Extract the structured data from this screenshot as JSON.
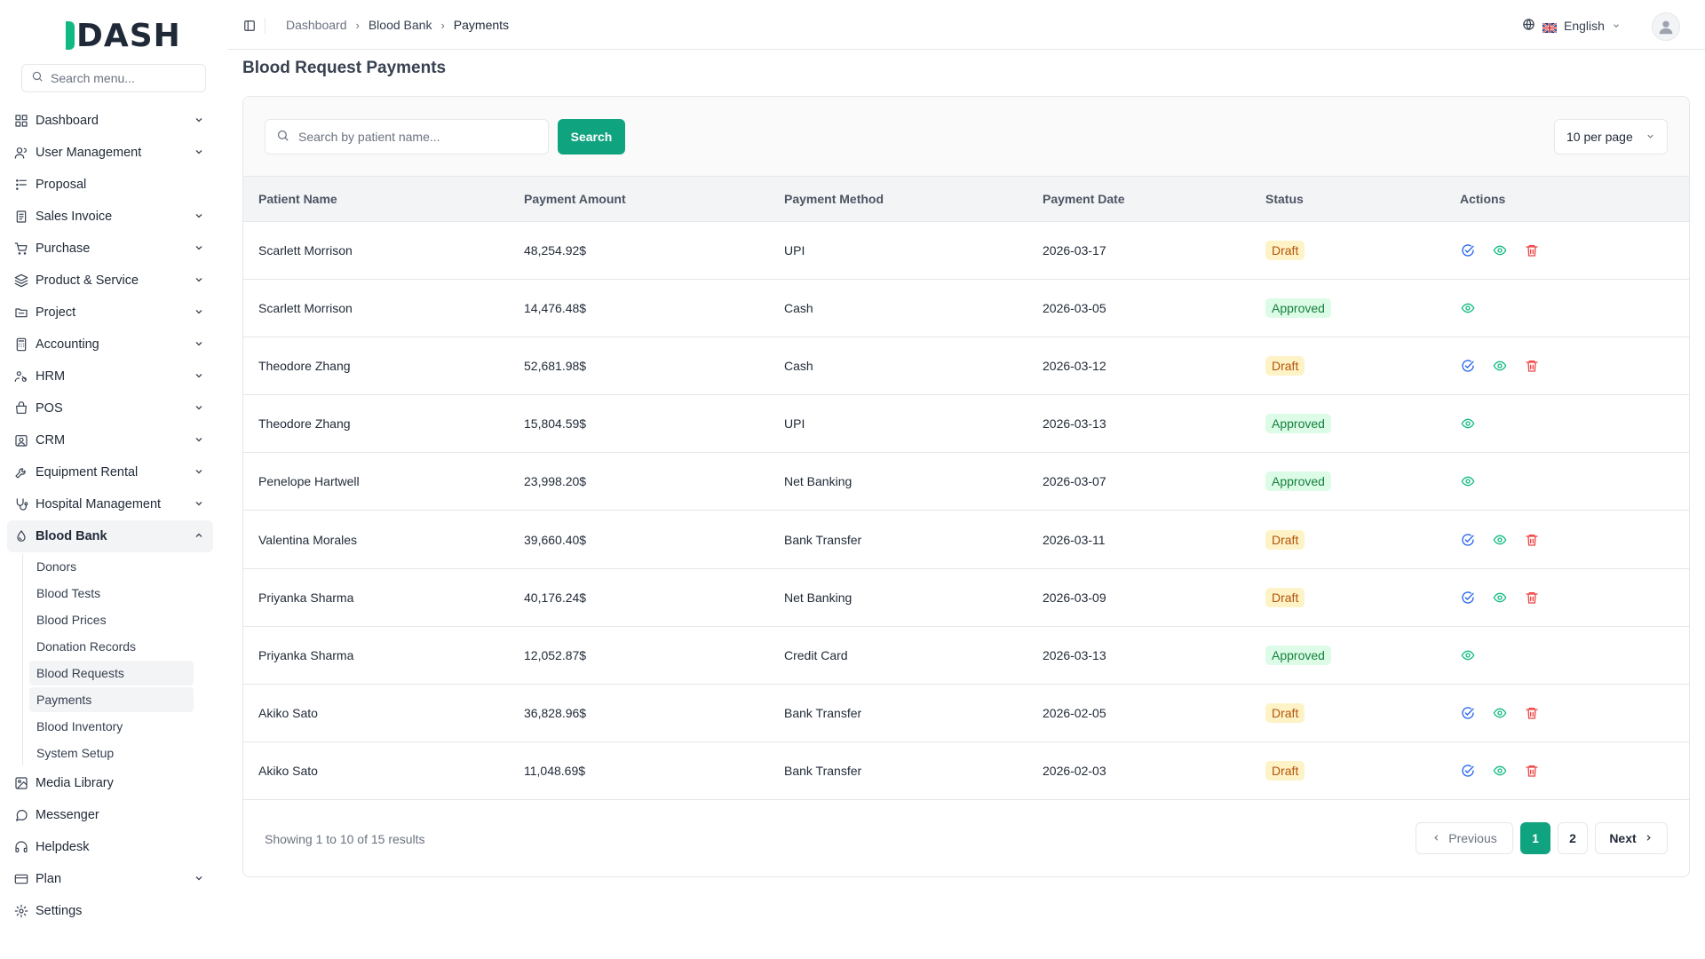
{
  "app": {
    "logo": "DASH"
  },
  "sidebar": {
    "search_placeholder": "Search menu...",
    "items": [
      {
        "label": "Dashboard",
        "icon": "dashboard-grid-icon",
        "has_chevron": true
      },
      {
        "label": "User Management",
        "icon": "users-icon",
        "has_chevron": true
      },
      {
        "label": "Proposal",
        "icon": "proposal-icon",
        "has_chevron": false
      },
      {
        "label": "Sales Invoice",
        "icon": "invoice-icon",
        "has_chevron": true
      },
      {
        "label": "Purchase",
        "icon": "cart-icon",
        "has_chevron": true
      },
      {
        "label": "Product & Service",
        "icon": "layers-icon",
        "has_chevron": true
      },
      {
        "label": "Project",
        "icon": "folder-icon",
        "has_chevron": true
      },
      {
        "label": "Accounting",
        "icon": "calculator-icon",
        "has_chevron": true
      },
      {
        "label": "HRM",
        "icon": "hrm-icon",
        "has_chevron": true
      },
      {
        "label": "POS",
        "icon": "pos-icon",
        "has_chevron": true
      },
      {
        "label": "CRM",
        "icon": "crm-icon",
        "has_chevron": true
      },
      {
        "label": "Equipment Rental",
        "icon": "wrench-icon",
        "has_chevron": true
      },
      {
        "label": "Hospital Management",
        "icon": "stethoscope-icon",
        "has_chevron": true
      },
      {
        "label": "Blood Bank",
        "icon": "blood-drop-icon",
        "has_chevron": true,
        "active": true
      }
    ],
    "blood_bank_sub": [
      {
        "label": "Donors"
      },
      {
        "label": "Blood Tests"
      },
      {
        "label": "Blood Prices"
      },
      {
        "label": "Donation Records"
      },
      {
        "label": "Blood Requests"
      },
      {
        "label": "Payments"
      },
      {
        "label": "Blood Inventory"
      },
      {
        "label": "System Setup"
      }
    ],
    "items_after": [
      {
        "label": "Media Library",
        "icon": "image-icon",
        "has_chevron": false
      },
      {
        "label": "Messenger",
        "icon": "chat-icon",
        "has_chevron": false
      },
      {
        "label": "Helpdesk",
        "icon": "headset-icon",
        "has_chevron": false
      },
      {
        "label": "Plan",
        "icon": "card-icon",
        "has_chevron": true
      },
      {
        "label": "Settings",
        "icon": "gear-icon",
        "has_chevron": false
      }
    ]
  },
  "topbar": {
    "breadcrumb": [
      "Dashboard",
      "Blood Bank",
      "Payments"
    ],
    "language": "English"
  },
  "page": {
    "title": "Blood Request Payments"
  },
  "toolbar": {
    "search_placeholder": "Search by patient name...",
    "search_label": "Search",
    "per_page": "10 per page"
  },
  "table": {
    "headers": [
      "Patient Name",
      "Payment Amount",
      "Payment Method",
      "Payment Date",
      "Status",
      "Actions"
    ],
    "rows": [
      {
        "name": "Scarlett Morrison",
        "amount": "48,254.92$",
        "method": "UPI",
        "date": "2026-03-17",
        "status": "Draft"
      },
      {
        "name": "Scarlett Morrison",
        "amount": "14,476.48$",
        "method": "Cash",
        "date": "2026-03-05",
        "status": "Approved"
      },
      {
        "name": "Theodore Zhang",
        "amount": "52,681.98$",
        "method": "Cash",
        "date": "2026-03-12",
        "status": "Draft"
      },
      {
        "name": "Theodore Zhang",
        "amount": "15,804.59$",
        "method": "UPI",
        "date": "2026-03-13",
        "status": "Approved"
      },
      {
        "name": "Penelope Hartwell",
        "amount": "23,998.20$",
        "method": "Net Banking",
        "date": "2026-03-07",
        "status": "Approved"
      },
      {
        "name": "Valentina Morales",
        "amount": "39,660.40$",
        "method": "Bank Transfer",
        "date": "2026-03-11",
        "status": "Draft"
      },
      {
        "name": "Priyanka Sharma",
        "amount": "40,176.24$",
        "method": "Net Banking",
        "date": "2026-03-09",
        "status": "Draft"
      },
      {
        "name": "Priyanka Sharma",
        "amount": "12,052.87$",
        "method": "Credit Card",
        "date": "2026-03-13",
        "status": "Approved"
      },
      {
        "name": "Akiko Sato",
        "amount": "36,828.96$",
        "method": "Bank Transfer",
        "date": "2026-02-05",
        "status": "Draft"
      },
      {
        "name": "Akiko Sato",
        "amount": "11,048.69$",
        "method": "Bank Transfer",
        "date": "2026-02-03",
        "status": "Draft"
      }
    ]
  },
  "pagination": {
    "summary": "Showing 1 to 10 of 15 results",
    "previous": "Previous",
    "pages": [
      "1",
      "2"
    ],
    "current": "1",
    "next": "Next"
  },
  "colors": {
    "accent": "#10a37f",
    "draft_bg": "#fef3c7",
    "draft_text": "#b45309",
    "approved_bg": "#dcfce7",
    "approved_text": "#15803d",
    "approve_icon": "#2563eb",
    "view_icon": "#10b981",
    "delete_icon": "#ef4444"
  }
}
